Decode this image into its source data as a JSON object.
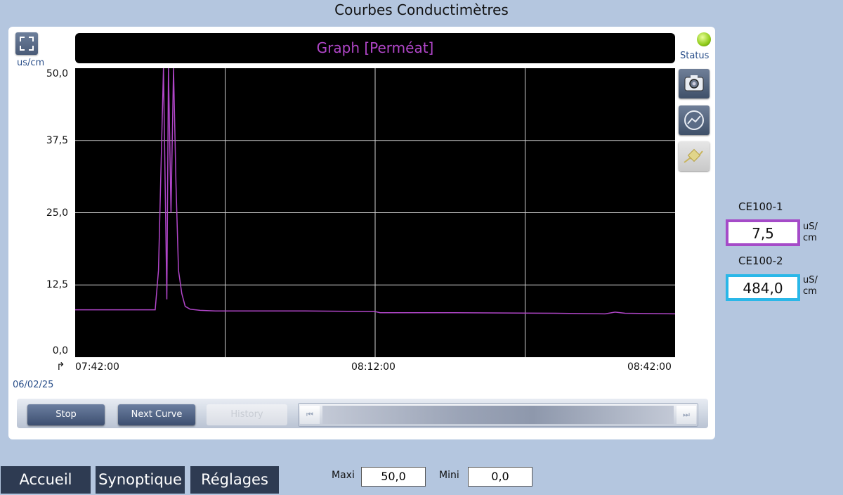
{
  "window": {
    "title": "Courbes Conductimètres"
  },
  "graph": {
    "header": "Graph [Perméat]",
    "y_unit": "us/cm",
    "date": "06/02/25",
    "status_label": "Status",
    "status_color": "#8fcb1a"
  },
  "chart_data": {
    "type": "line",
    "title": "Graph [Perméat]",
    "ylabel": "us/cm",
    "ylim": [
      0,
      50
    ],
    "y_ticks": [
      "50,0",
      "37,5",
      "25,0",
      "12,5",
      "0,0"
    ],
    "x_ticks": [
      "07:42:00",
      "08:12:00",
      "08:42:00"
    ],
    "xlim": [
      "07:42:00",
      "08:42:00"
    ],
    "grid": true,
    "background": "#000000",
    "series": [
      {
        "color": "#b146c9",
        "x": [
          "07:42:00",
          "07:50:00",
          "07:50:20",
          "07:50:50",
          "07:51:10",
          "07:51:20",
          "07:51:35",
          "07:51:50",
          "07:52:05",
          "07:52:20",
          "07:52:40",
          "07:53:00",
          "07:53:30",
          "07:54:30",
          "07:56:00",
          "08:00:00",
          "08:05:00",
          "08:12:00",
          "08:12:30",
          "08:20:00",
          "08:30:00",
          "08:35:00",
          "08:36:00",
          "08:37:00",
          "08:42:00"
        ],
        "values": [
          8.2,
          8.2,
          15,
          50,
          10,
          50,
          25,
          50,
          30,
          15,
          11,
          8.8,
          8.3,
          8.1,
          8.0,
          8.0,
          8.0,
          7.9,
          7.7,
          7.7,
          7.6,
          7.5,
          7.8,
          7.6,
          7.5
        ]
      }
    ]
  },
  "controls": {
    "stop": "Stop",
    "next_curve": "Next Curve",
    "history": "History",
    "scroll_left_icon": "skip-back-icon",
    "scroll_right_icon": "skip-forward-icon"
  },
  "sensors": [
    {
      "label": "CE100-1",
      "value": "7,5",
      "unit_line1": "uS/",
      "unit_line2": "cm",
      "color": "#a54bc8"
    },
    {
      "label": "CE100-2",
      "value": "484,0",
      "unit_line1": "uS/",
      "unit_line2": "cm",
      "color": "#2ab7e8"
    }
  ],
  "nav": {
    "home": "Accueil",
    "synoptic": "Synoptique",
    "settings": "Réglages"
  },
  "range": {
    "max_label": "Maxi",
    "max_value": "50,0",
    "min_label": "Mini",
    "min_value": "0,0"
  }
}
